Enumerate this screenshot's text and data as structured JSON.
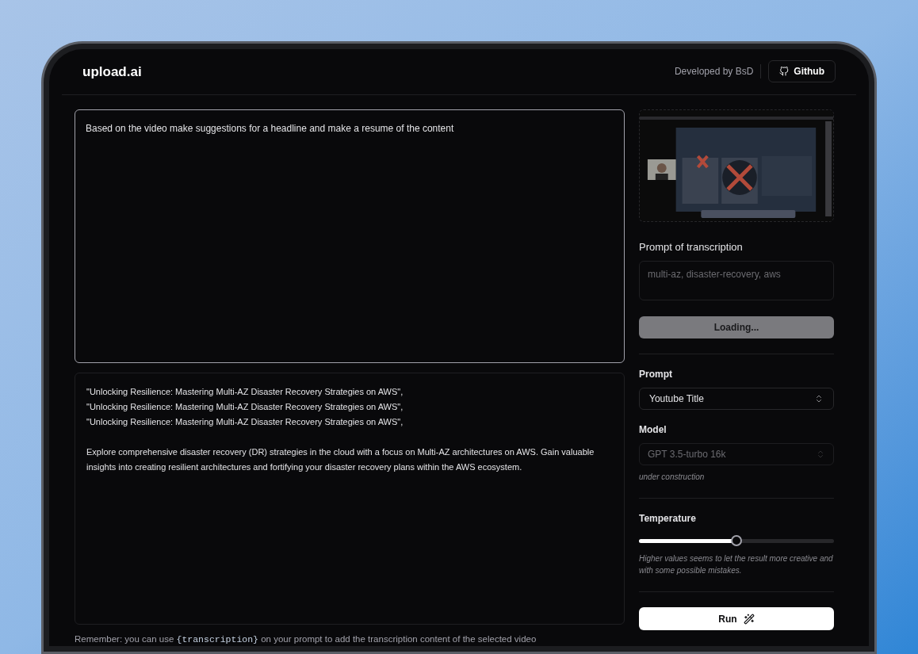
{
  "header": {
    "logo": "upload.ai",
    "credit": "Developed by BsD",
    "github_button": "Github"
  },
  "prompt_editor": {
    "value": "Based on the video make suggestions for a headline and make a resume of the content"
  },
  "result": {
    "titles": [
      "\"Unlocking Resilience: Mastering Multi-AZ Disaster Recovery Strategies on AWS\",",
      "\"Unlocking Resilience: Mastering Multi-AZ Disaster Recovery Strategies on AWS\",",
      "\"Unlocking Resilience: Mastering Multi-AZ Disaster Recovery Strategies on AWS\","
    ],
    "description": "Explore comprehensive disaster recovery (DR) strategies in the cloud with a focus on Multi-AZ architectures on AWS. Gain valuable insights into creating resilient architectures and fortifying your disaster recovery plans within the AWS ecosystem."
  },
  "hint": {
    "before": "Remember: you can use ",
    "code": "{transcription}",
    "after": " on your prompt to add the transcription content of the selected video"
  },
  "sidebar": {
    "transcription_label": "Prompt of transcription",
    "transcription_field": {
      "placeholder": "multi-az, disaster-recovery, aws"
    },
    "upload_button": {
      "label": "Loading...",
      "disabled": true
    },
    "prompt_label": "Prompt",
    "prompt_select": {
      "value": "Youtube Title",
      "disabled": false
    },
    "model_label": "Model",
    "model_select": {
      "value": "GPT 3.5-turbo 16k",
      "disabled": true
    },
    "model_note": "under construction",
    "temperature_label": "Temperature",
    "temperature": {
      "level": 0.5
    },
    "temperature_note": "Higher values seems to let the result more creative and with some possible mistakes.",
    "run_button": "Run"
  }
}
